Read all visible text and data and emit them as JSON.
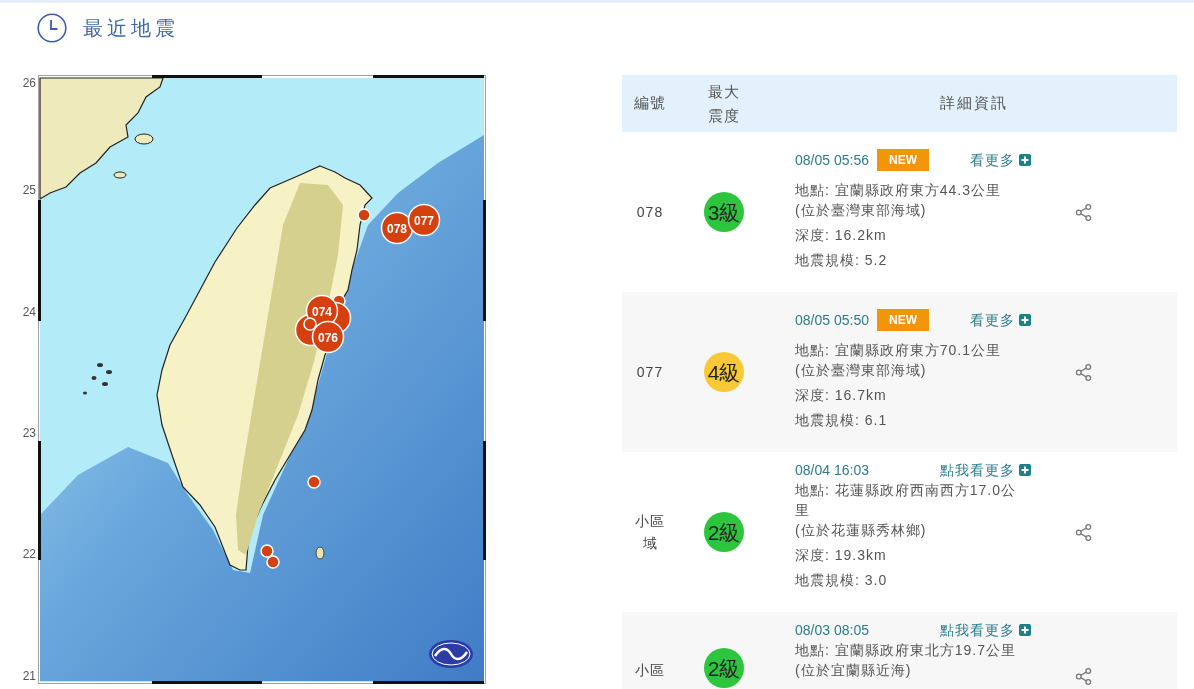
{
  "section": {
    "title": "最近地震"
  },
  "map": {
    "y_axis_labels": [
      "26",
      "25",
      "24",
      "23",
      "22",
      "21"
    ],
    "markers": [
      {
        "kind": "small"
      },
      {
        "kind": "large",
        "label": "078"
      },
      {
        "kind": "large",
        "label": "077"
      },
      {
        "kind": "small"
      },
      {
        "kind": "large"
      },
      {
        "kind": "large"
      },
      {
        "kind": "large",
        "label": "074"
      },
      {
        "kind": "large",
        "label": "076"
      },
      {
        "kind": "small"
      },
      {
        "kind": "small"
      },
      {
        "kind": "small"
      },
      {
        "kind": "small"
      }
    ]
  },
  "table": {
    "columns": [
      "編號",
      "最大震度",
      "詳細資訊"
    ],
    "rows": [
      {
        "number": "078",
        "intensity": "3級",
        "color": "#2dc53d",
        "time": "08/05 05:56",
        "tag": "NEW",
        "more": "看更多",
        "location": "地點: 宜蘭縣政府東方44.3公里",
        "area": "(位於臺灣東部海域)",
        "depth": "深度: 16.2km",
        "magnitude": "地震規模: 5.2"
      },
      {
        "number": "077",
        "intensity": "4級",
        "color": "#f8c934",
        "time": "08/05 05:50",
        "tag": "NEW",
        "more": "看更多",
        "location": "地點: 宜蘭縣政府東方70.1公里",
        "area": "(位於臺灣東部海域)",
        "depth": "深度: 16.7km",
        "magnitude": "地震規模: 6.1"
      },
      {
        "number": "小區域",
        "intensity": "2級",
        "color": "#2dc53d",
        "time": "08/04 16:03",
        "more": "點我看更多",
        "location": "地點: 花蓮縣政府西南西方17.0公里",
        "area": "(位於花蓮縣秀林鄉)",
        "depth": "深度: 19.3km",
        "magnitude": "地震規模: 3.0"
      },
      {
        "number": "小區",
        "intensity": "2級",
        "color": "#2dc53d",
        "time": "08/03 08:05",
        "more": "點我看更多",
        "location": "地點: 宜蘭縣政府東北方19.7公里",
        "area": "(位於宜蘭縣近海)"
      }
    ]
  }
}
